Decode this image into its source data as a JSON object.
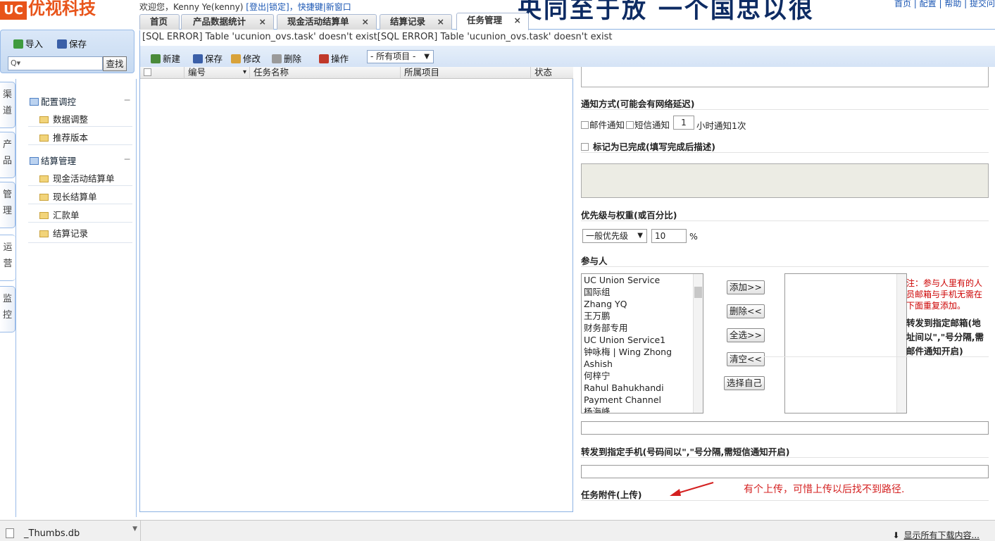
{
  "header": {
    "logo_mark": "UC",
    "logo_text": "优视科技",
    "welcome_prefix": "欢迎您，Kenny Ye(kenny) ",
    "logout": "[登出|锁定]",
    "shortcuts": "，快捷键|新窗口",
    "banner": "央同至于放 一个国忠以很",
    "toplinks": "首页 | 配置 | 帮助 | 提交问"
  },
  "tabs": [
    {
      "label": "首页",
      "closable": false
    },
    {
      "label": "产品数据统计",
      "closable": true
    },
    {
      "label": "现金活动结算单",
      "closable": true
    },
    {
      "label": "结算记录",
      "closable": true
    },
    {
      "label": "任务管理",
      "closable": true,
      "active": true
    }
  ],
  "close_glyph": "×",
  "error_message": "[SQL ERROR] Table 'ucunion_ovs.task' doesn't exist[SQL ERROR] Table 'ucunion_ovs.task' doesn't exist",
  "left_toolbar": {
    "import": "导入",
    "save": "保存",
    "search_placeholder": "Q▾",
    "search_button": "查找"
  },
  "side_tabs": [
    "渠道",
    "产品",
    "管理",
    "运营",
    "监控"
  ],
  "tree": {
    "groups": [
      {
        "label": "配置调控",
        "items": [
          "数据调整",
          "推荐版本"
        ]
      },
      {
        "label": "结算管理",
        "items": [
          "现金活动结算单",
          "现长结算单",
          "汇款单",
          "结算记录"
        ]
      }
    ],
    "collapse_glyph": "−"
  },
  "main_toolbar": {
    "new": "新建",
    "save": "保存",
    "edit": "修改",
    "delete": "删除",
    "action": "操作",
    "project_select": "- 所有项目 -",
    "dropdown_glyph": "▼"
  },
  "grid": {
    "columns": [
      "",
      "编号",
      "任务名称",
      "所属项目",
      "状态"
    ],
    "sort_glyph": "▾"
  },
  "form": {
    "notify_title": "通知方式(可能会有网络延迟)",
    "email_notify": "邮件通知",
    "sms_notify": "短信通知",
    "hours_value": "1",
    "hours_suffix": "小时通知1次",
    "mark_done": "标记为已完成(填写完成后描述)",
    "priority_title": "优先级与权重(或百分比)",
    "priority_value": "一般优先级",
    "weight_value": "10",
    "percent": "%",
    "participants_title": "参与人",
    "participants": [
      "UC Union Service",
      "国际组",
      "Zhang YQ",
      "王万鹏",
      "财务部专用",
      "UC Union Service1",
      "钟咏梅 | Wing Zhong",
      "Ashish",
      "何梓宁",
      "Rahul Bahukhandi",
      "Payment Channel",
      "杨海峰"
    ],
    "buttons": {
      "add": "添加>>",
      "remove": "删除<<",
      "select_all": "全选>>",
      "clear": "清空<<",
      "select_self": "选择自己"
    },
    "note": "注：参与人里有的人员邮箱与手机无需在下面重复添加。",
    "forward_email": "转发到指定邮箱(地址间以\",\"号分隔,需邮件通知开启)",
    "forward_phone": "转发到指定手机(号码间以\",\"号分隔,需短信通知开启)",
    "attachment": "任务附件(上传)",
    "annotation": "有个上传，可惜上传以后找不到路径."
  },
  "download_bar": {
    "file": "_Thumbs.db",
    "show_all": "显示所有下载内容..."
  },
  "colors": {
    "brand": "#e8541a",
    "border": "#99bbe8",
    "annotation": "#d42020",
    "note": "#cc0000"
  }
}
